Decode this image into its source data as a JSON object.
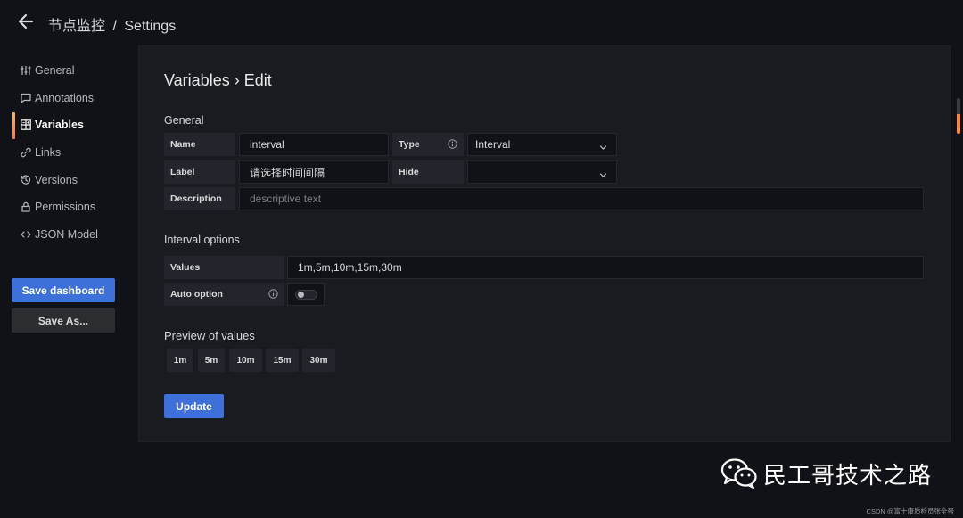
{
  "header": {
    "dashboard": "节点监控",
    "separator": "/",
    "page": "Settings"
  },
  "sidebar": {
    "items": [
      {
        "label": "General",
        "icon": "sliders-icon",
        "active": false
      },
      {
        "label": "Annotations",
        "icon": "comment-icon",
        "active": false
      },
      {
        "label": "Variables",
        "icon": "calculator-icon",
        "active": true
      },
      {
        "label": "Links",
        "icon": "link-icon",
        "active": false
      },
      {
        "label": "Versions",
        "icon": "history-icon",
        "active": false
      },
      {
        "label": "Permissions",
        "icon": "lock-icon",
        "active": false
      },
      {
        "label": "JSON Model",
        "icon": "code-icon",
        "active": false
      }
    ],
    "save_label": "Save dashboard",
    "save_as_label": "Save As..."
  },
  "panel": {
    "title": "Variables › Edit",
    "general": {
      "heading": "General",
      "name_label": "Name",
      "name_value": "interval",
      "type_label": "Type",
      "type_value": "Interval",
      "label_label": "Label",
      "label_value": "请选择时间间隔",
      "hide_label": "Hide",
      "hide_value": "",
      "description_label": "Description",
      "description_placeholder": "descriptive text"
    },
    "interval": {
      "heading": "Interval options",
      "values_label": "Values",
      "values_value": "1m,5m,10m,15m,30m",
      "auto_label": "Auto option",
      "auto_enabled": false
    },
    "preview": {
      "heading": "Preview of values",
      "values": [
        "1m",
        "5m",
        "10m",
        "15m",
        "30m"
      ]
    },
    "update_label": "Update"
  },
  "watermark": {
    "text": "民工哥技术之路",
    "credit": "CSDN @富士康质检员张全蛋"
  },
  "colors": {
    "accent": "#3d71d9",
    "active_indicator": "#ff7941",
    "background": "#111217",
    "panel": "#181b1f"
  }
}
